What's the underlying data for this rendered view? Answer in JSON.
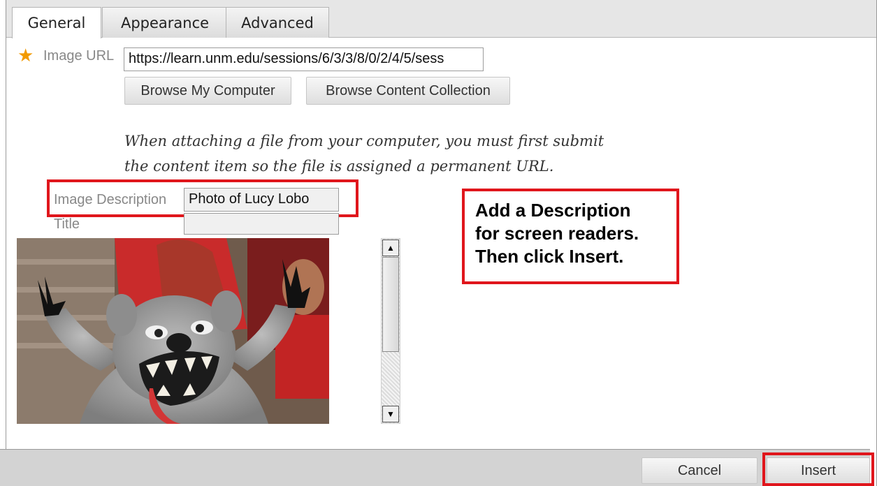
{
  "tabs": [
    {
      "label": "General",
      "active": true
    },
    {
      "label": "Appearance",
      "active": false
    },
    {
      "label": "Advanced",
      "active": false
    }
  ],
  "form": {
    "image_url_label": "Image URL",
    "image_url_value": "https://learn.unm.edu/sessions/6/3/3/8/0/2/4/5/sess",
    "browse_computer_label": "Browse My Computer",
    "browse_collection_label": "Browse Content Collection",
    "note_line1": "When attaching a file from your computer, you must first submit",
    "note_line2": "the content item so the file is assigned a permanent URL.",
    "description_label": "Image Description",
    "description_value": "Photo of Lucy Lobo",
    "title_label": "Title",
    "title_value": ""
  },
  "callout": {
    "line1": "Add a Description",
    "line2": "for screen readers.",
    "line3": "Then click Insert."
  },
  "footer": {
    "cancel_label": "Cancel",
    "insert_label": "Insert"
  },
  "colors": {
    "required_star": "#f29a00",
    "highlight_red": "#e0161c",
    "footer_bg": "#d3d3d3"
  },
  "icons": {
    "required": "asterisk-icon",
    "scroll_up": "arrow-up-icon",
    "scroll_down": "arrow-down-icon"
  }
}
